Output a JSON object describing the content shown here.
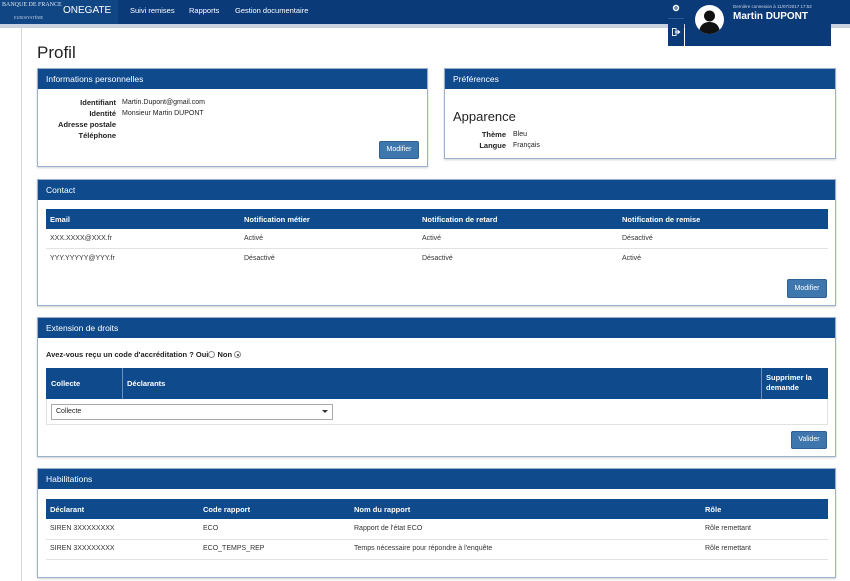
{
  "header": {
    "logo_line1": "BANQUE DE FRANCE",
    "logo_line2": "EUROSYSTÈME",
    "app_name": "ONEGATE",
    "nav": [
      "Suivi remises",
      "Rapports",
      "Gestion documentaire"
    ],
    "last_connection": "Dernière connexion à 11/07/2017 17:52",
    "user_name": "Martin DUPONT",
    "icons": [
      "gear-icon",
      "logout-icon",
      "user-avatar-icon"
    ]
  },
  "page_title": "Profil",
  "personal": {
    "title": "Informations personnelles",
    "labels": [
      "Identifiant",
      "Identité",
      "Adresse postale",
      "Téléphone"
    ],
    "values": [
      "Martin.Dupont@gmail.com",
      "Monsieur Martin DUPONT",
      "",
      ""
    ],
    "button": "Modifier"
  },
  "preferences": {
    "title": "Préférences",
    "subtitle": "Apparence",
    "labels": [
      "Thème",
      "Langue"
    ],
    "values": [
      "Bleu",
      "Français"
    ]
  },
  "contact": {
    "title": "Contact",
    "columns": [
      "Email",
      "Notification métier",
      "Notification de retard",
      "Notification de remise"
    ],
    "rows": [
      [
        "XXX.XXXX@XXX.fr",
        "Activé",
        "Activé",
        "Désactivé"
      ],
      [
        "YYY.YYYYY@YYY.fr",
        "Désactivé",
        "Désactivé",
        "Activé"
      ]
    ],
    "button": "Modifier"
  },
  "extension": {
    "title": "Extension de droits",
    "question": "Avez-vous reçu un code d'accréditation ?",
    "option_yes": "Oui",
    "option_no": "Non",
    "selected": "Non",
    "columns": [
      "Collecte",
      "Déclarants",
      "Supprimer la",
      "demande"
    ],
    "select_value": "Collecte",
    "button": "Valider"
  },
  "habilitations": {
    "title": "Habilitations",
    "columns": [
      "Déclarant",
      "Code rapport",
      "Nom du rapport",
      "Rôle"
    ],
    "rows": [
      [
        "SIREN 3XXXXXXXX",
        "ECO",
        "Rapport de l'état ECO",
        "Rôle remettant"
      ],
      [
        "SIREN 3XXXXXXXX",
        "ECO_TEMPS_REP",
        "Temps nécessaire pour répondre à l'enquête",
        "Rôle remettant"
      ]
    ]
  }
}
